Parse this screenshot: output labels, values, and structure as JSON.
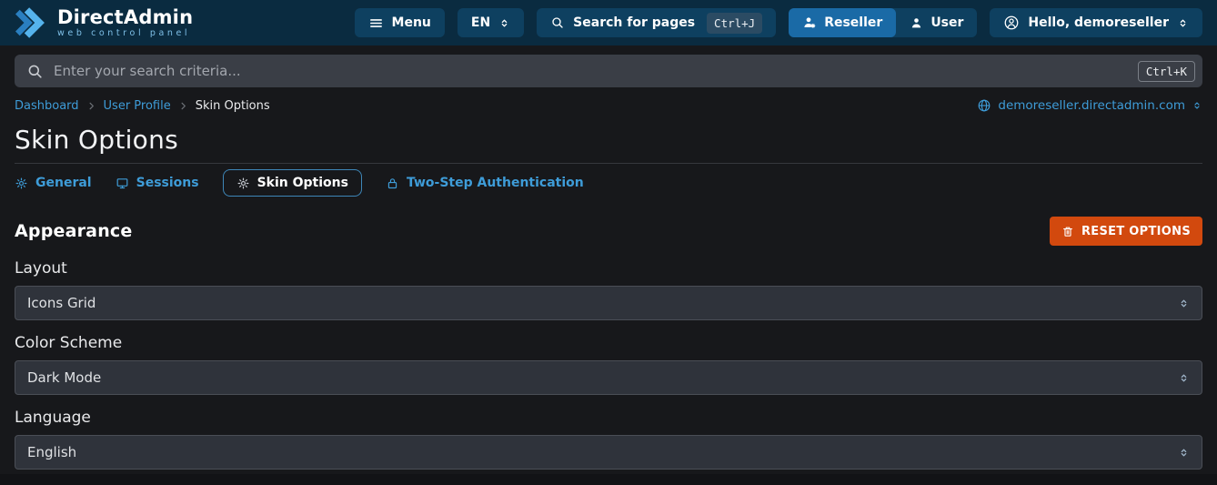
{
  "colors": {
    "navbar_bg": "#0A2B40",
    "navbar_button_bg": "#0E4060",
    "active_segment_bg": "#1A6AA6",
    "accent_blue": "#3E9CD8",
    "logo_blue_light": "#55B3EC",
    "logo_blue_dark": "#2A7FC0",
    "page_bg": "#17181B",
    "searchbar_bg": "#3A3E46",
    "select_bg": "#2F333B",
    "select_border": "#4A4E56",
    "reset_orange": "#D2490E"
  },
  "navbar": {
    "brand_title": "DirectAdmin",
    "brand_subtitle": "web control panel",
    "menu_label": "Menu",
    "language_label": "EN",
    "search_pages_label": "Search for pages",
    "search_pages_shortcut": "Ctrl+J",
    "role_reseller_label": "Reseller",
    "role_user_label": "User",
    "account_label": "Hello, demoreseller"
  },
  "search": {
    "placeholder": "Enter your search criteria...",
    "shortcut": "Ctrl+K"
  },
  "breadcrumb": {
    "items": [
      {
        "label": "Dashboard"
      },
      {
        "label": "User Profile"
      },
      {
        "label": "Skin Options"
      }
    ],
    "domain": "demoreseller.directadmin.com"
  },
  "page": {
    "title": "Skin Options"
  },
  "tabs": [
    {
      "label": "General"
    },
    {
      "label": "Sessions"
    },
    {
      "label": "Skin Options",
      "active": true
    },
    {
      "label": "Two-Step Authentication"
    }
  ],
  "appearance": {
    "section_title": "Appearance",
    "reset_label": "RESET OPTIONS",
    "fields": [
      {
        "label": "Layout",
        "value": "Icons Grid"
      },
      {
        "label": "Color Scheme",
        "value": "Dark Mode"
      },
      {
        "label": "Language",
        "value": "English"
      }
    ]
  }
}
